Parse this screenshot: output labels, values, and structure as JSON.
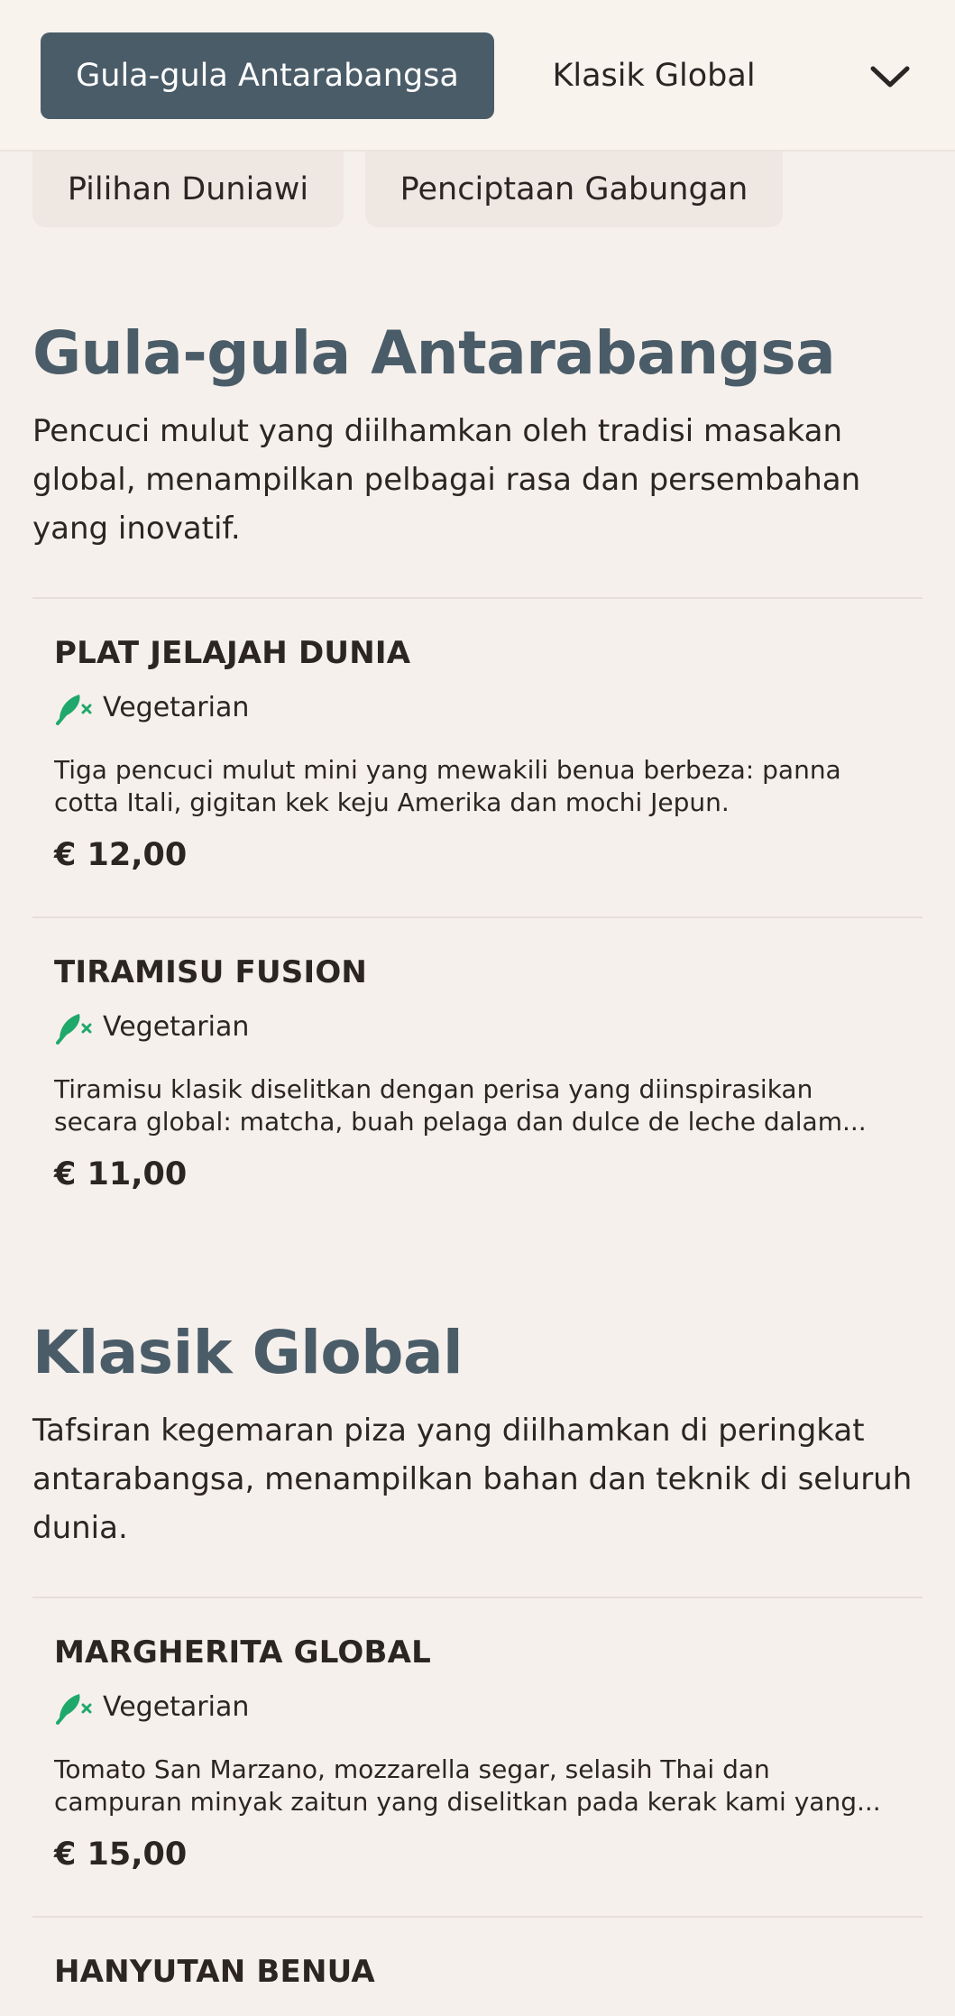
{
  "nav": {
    "tabs": [
      {
        "label": "Gula-gula Antarabangsa",
        "active": true
      },
      {
        "label": "Klasik Global",
        "active": false
      }
    ],
    "chips": [
      {
        "label": "Pilihan Duniawi"
      },
      {
        "label": "Penciptaan Gabungan"
      }
    ],
    "more_icon": "chevron-down-icon"
  },
  "sections": [
    {
      "title": "Gula-gula Antarabangsa",
      "description": "Pencuci mulut yang diilhamkan oleh tradisi masakan global, menampilkan pelbagai rasa dan persembahan yang inovatif.",
      "items": [
        {
          "name": "PLAT JELAJAH DUNIA",
          "tag": "Vegetarian",
          "description": "Tiga pencuci mulut mini yang mewakili benua berbeza: panna cotta Itali, gigitan kek keju Amerika dan mochi Jepun.",
          "price": "€ 12,00"
        },
        {
          "name": "TIRAMISU FUSION",
          "tag": "Vegetarian",
          "description": "Tiramisu klasik diselitkan dengan perisa yang diinspirasikan secara global: matcha, buah pelaga dan dulce de leche dalam...",
          "price": "€ 11,00"
        }
      ]
    },
    {
      "title": "Klasik Global",
      "description": "Tafsiran kegemaran piza yang diilhamkan di peringkat antarabangsa, menampilkan bahan dan teknik di seluruh dunia.",
      "items": [
        {
          "name": "MARGHERITA GLOBAL",
          "tag": "Vegetarian",
          "description": "Tomato San Marzano, mozzarella segar, selasih Thai dan campuran minyak zaitun yang diselitkan pada kerak kami yang...",
          "price": "€ 15,00"
        },
        {
          "name": "HANYUTAN BENUA"
        }
      ]
    }
  ],
  "colors": {
    "background": "#f6f0ec",
    "accent": "#4a5c68",
    "vegetarian_icon": "#1fa86b"
  }
}
